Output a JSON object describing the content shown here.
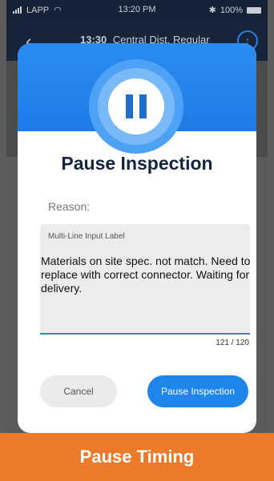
{
  "status_bar": {
    "carrier": "LAPP",
    "time": "13:20 PM",
    "battery": "100%"
  },
  "app_bar": {
    "time": "13:30",
    "title": "Central Dist. Regular"
  },
  "dialog": {
    "title": "Pause Inspection",
    "reason_label": "Reason:",
    "field_label": "Multi-Line Input Label",
    "field_value": "Materials on site spec. not match. Need to replace with correct connector. Waiting for delivery.",
    "char_counter": "121 / 120",
    "cancel_label": "Cancel",
    "confirm_label": "Pause Inspection"
  },
  "caption": "Pause Timing",
  "colors": {
    "accent": "#1e86eb",
    "caption": "#ec7a2b",
    "title": "#13243f"
  },
  "icons": [
    "signal-icon",
    "wifi-icon",
    "bluetooth-icon",
    "battery-icon",
    "back-icon",
    "upload-icon",
    "pause-icon"
  ]
}
